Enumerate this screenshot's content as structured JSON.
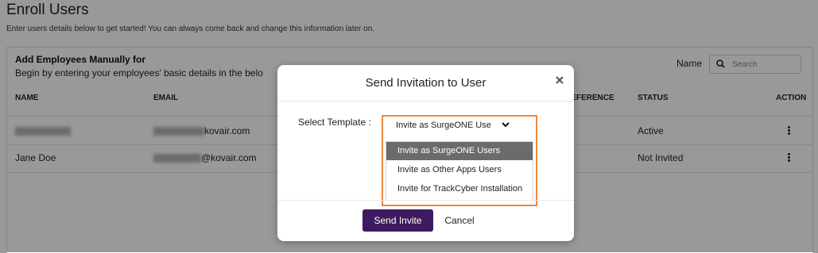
{
  "page": {
    "title": "Enroll Users",
    "subtitle": "Enter users details below to get started! You can always come back and change this information later on."
  },
  "card": {
    "title": "Add Employees Manually for",
    "description": "Begin by entering your employees' basic details in the belo",
    "name_label": "Name",
    "search_placeholder": "Search"
  },
  "table": {
    "columns": [
      "NAME",
      "EMAIL",
      "REFERENCE ID",
      "STATUS",
      "ACTION"
    ],
    "rows": [
      {
        "name": "",
        "email_suffix": "kovair.com",
        "status": "Active"
      },
      {
        "name": "Jane Doe",
        "email_suffix": "@kovair.com",
        "status": "Not Invited"
      }
    ]
  },
  "modal": {
    "title": "Send Invitation to User",
    "select_label": "Select Template :",
    "selected_value": "Invite as SurgeONE Use",
    "options": [
      "Invite as SurgeONE Users",
      "Invite as Other Apps Users",
      "Invite for TrackCyber Installation"
    ],
    "send_label": "Send Invite",
    "cancel_label": "Cancel"
  },
  "colors": {
    "primary": "#3d1b5e",
    "highlight_frame": "#f0883a",
    "selected_option": "#6b6b6b"
  }
}
